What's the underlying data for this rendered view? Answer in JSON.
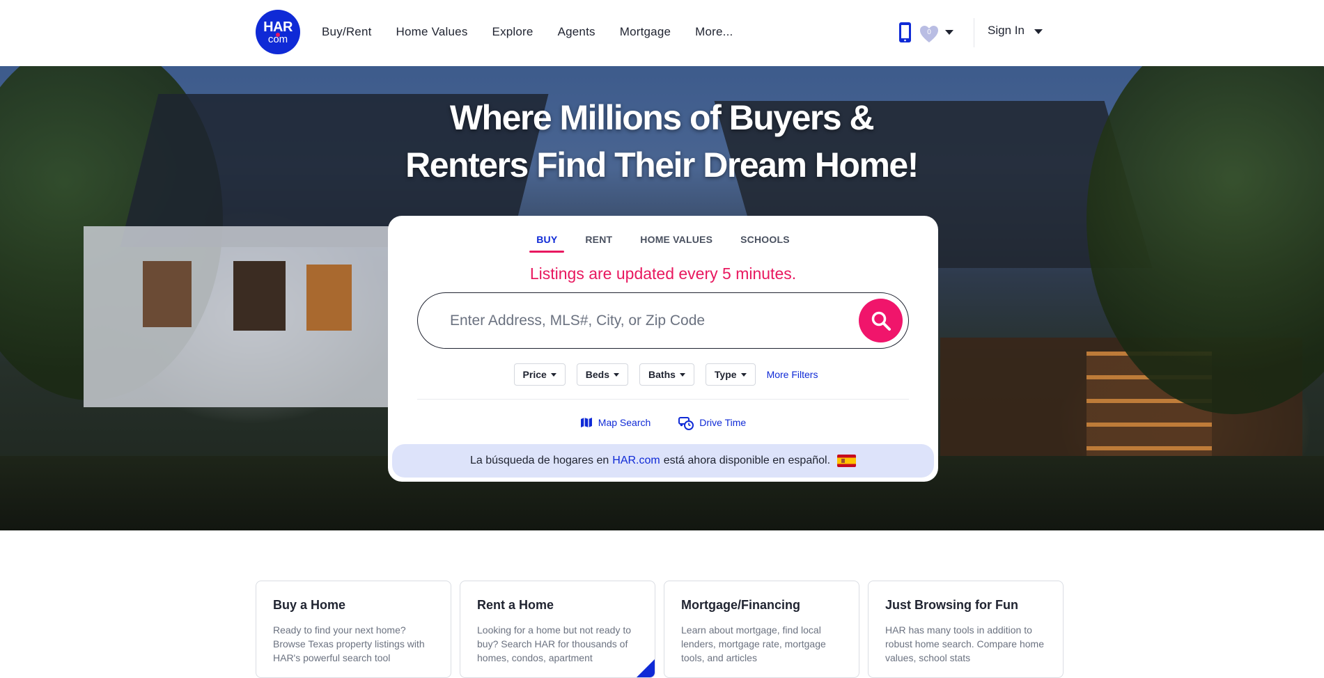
{
  "header": {
    "logo": {
      "line1": "HAR",
      "line2": "com"
    },
    "nav": [
      "Buy/Rent",
      "Home Values",
      "Explore",
      "Agents",
      "Mortgage",
      "More..."
    ],
    "favorites_count": "0",
    "signin_label": "Sign In"
  },
  "hero": {
    "title_line1": "Where Millions of Buyers &",
    "title_line2": "Renters Find Their Dream Home!"
  },
  "search": {
    "tabs": [
      "BUY",
      "RENT",
      "HOME VALUES",
      "SCHOOLS"
    ],
    "active_tab": "BUY",
    "notice": "Listings are updated every 5 minutes.",
    "placeholder": "Enter Address, MLS#, City, or Zip Code",
    "filters": [
      "Price",
      "Beds",
      "Baths",
      "Type"
    ],
    "more_filters": "More Filters",
    "map_search": "Map Search",
    "drive_time": "Drive Time",
    "espanol_before": "La búsqueda de hogares en",
    "espanol_link": "HAR.com",
    "espanol_after": "está ahora disponible en español."
  },
  "features": [
    {
      "title": "Buy a Home",
      "text": "Ready to find your next home? Browse Texas property listings with HAR's powerful search tool"
    },
    {
      "title": "Rent a Home",
      "text": "Looking for a home but not ready to buy? Search HAR for thousands of homes, condos, apartment"
    },
    {
      "title": "Mortgage/Financing",
      "text": "Learn about mortgage, find local lenders, mortgage rate, mortgage tools, and articles"
    },
    {
      "title": "Just Browsing for Fun",
      "text": "HAR has many tools in addition to robust home search. Compare home values, school stats"
    }
  ],
  "colors": {
    "brand_blue": "#0f2ad6",
    "brand_pink": "#e8185f",
    "banner_bg": "#dde3fa"
  }
}
